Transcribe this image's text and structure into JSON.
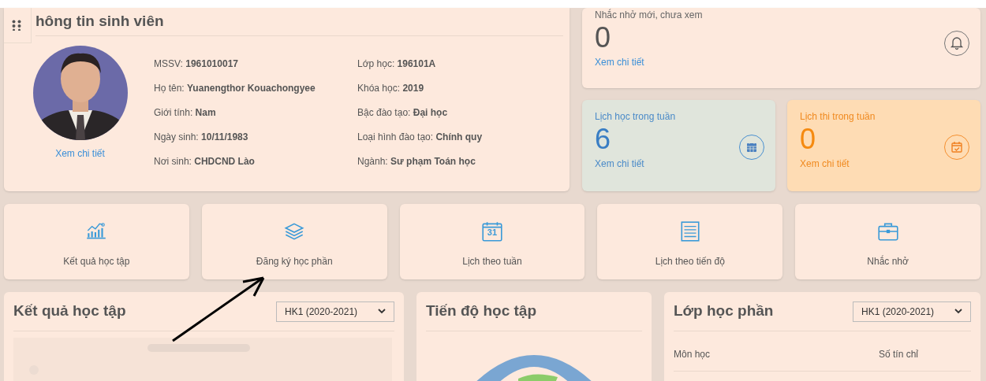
{
  "student_card": {
    "title": "hông tin sinh viên",
    "detail_link": "Xem chi tiết",
    "fields_left": [
      "MSSV: **1961010017**",
      "Họ tên: **Yuanengthor Kouachongyee**",
      "Giới tính: **Nam**",
      "Ngày sinh: **10/11/1983**",
      "Nơi sinh: **CHDCND Lào**"
    ],
    "fields_right": [
      "Lớp học: **196101A**",
      "Khóa học: **2019**",
      "Bậc đào tạo: **Đại học**",
      "Loại hình đào tạo: **Chính quy**",
      "Ngành: **Sư phạm Toán học**"
    ]
  },
  "reminder_card": {
    "kind": "neutral",
    "label": "Nhắc nhở mới, chưa xem",
    "count": "0",
    "link": "Xem chi tiết"
  },
  "stat_cards": [
    {
      "kind": "info",
      "label": "Lịch học trong tuần",
      "count": "6",
      "link": "Xem chi tiết"
    },
    {
      "kind": "warning",
      "label": "Lịch thi trong tuần",
      "count": "0",
      "link": "Xem chi tiết"
    }
  ],
  "shortcuts": [
    {
      "kind": "chart",
      "label": "Kết quả học tập"
    },
    {
      "kind": "layers",
      "label": "Đăng ký học phần"
    },
    {
      "kind": "calendar",
      "label": "Lịch theo tuần",
      "icon_text": "31"
    },
    {
      "kind": "list",
      "label": "Lịch theo tiến độ"
    },
    {
      "kind": "briefcase",
      "label": "Nhắc nhở"
    }
  ],
  "panels": [
    {
      "kind": "results",
      "title": "Kết quả học tập",
      "select": "HK1 (2020-2021)"
    },
    {
      "kind": "progress",
      "title": "Tiến độ học tập"
    },
    {
      "kind": "classes",
      "title": "Lớp học phần",
      "select": "HK1 (2020-2021)",
      "columns": [
        "Môn học",
        "Số tín chỉ"
      ]
    }
  ]
}
